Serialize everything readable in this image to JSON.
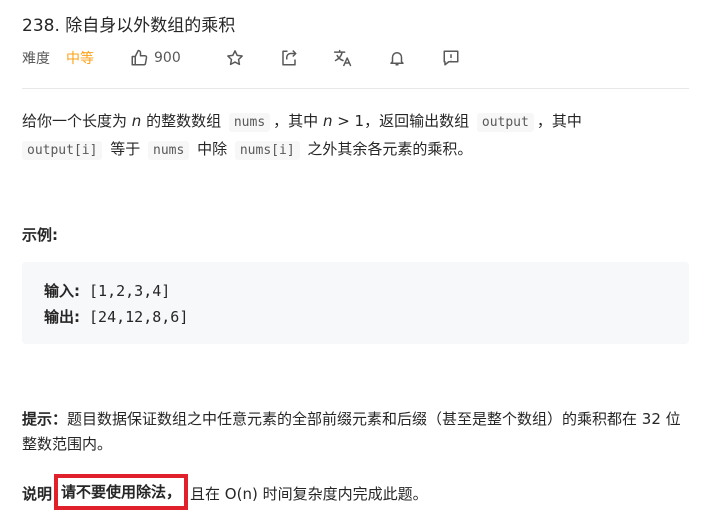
{
  "problem": {
    "title": "238. 除自身以外数组的乘积",
    "difficulty_label": "难度",
    "difficulty": "中等",
    "likes": "900"
  },
  "description": {
    "s1": "给你一个长度为 ",
    "n": "n",
    "s2": " 的整数数组 ",
    "nums": "nums",
    "s3": "，其中 ",
    "n2": "n",
    "s4": " > 1，返回输出数组 ",
    "output": "output",
    "s5": "，其中",
    "output_i": "output[i]",
    "s6": " 等于 ",
    "nums2": "nums",
    "s7": " 中除 ",
    "nums_i": "nums[i]",
    "s8": " 之外其余各元素的乘积。"
  },
  "example": {
    "title": "示例:",
    "input_label": "输入:",
    "input_value": " [1,2,3,4]",
    "output_label": "输出:",
    "output_value": " [24,12,8,6]"
  },
  "hint": {
    "label": "提示：",
    "text": "题目数据保证数组之中任意元素的全部前缀元素和后缀（甚至是整个数组）的乘积都在 32 位整数范围内。"
  },
  "note": {
    "label": "说明",
    "highlight": "请不要使用除法，",
    "text": "且在 O(n) 时间复杂度内完成此题。"
  },
  "colors": {
    "difficulty": "#ffa116",
    "highlight_box": "#e0202a"
  }
}
